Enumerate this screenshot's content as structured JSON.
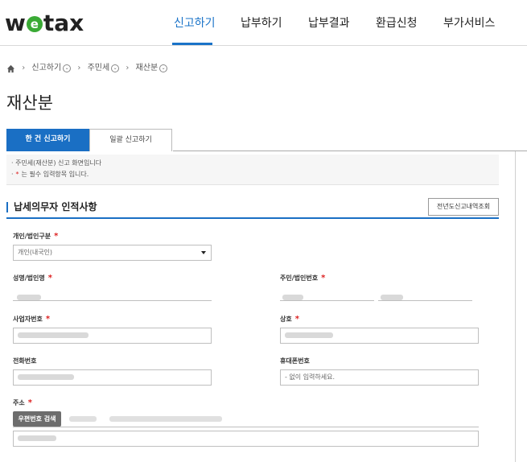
{
  "header": {
    "logo_before": "w",
    "logo_mark": "e",
    "logo_after": "tax",
    "nav": [
      "신고하기",
      "납부하기",
      "납부결과",
      "환급신청",
      "부가서비스"
    ],
    "active_nav": "신고하기"
  },
  "breadcrumb": {
    "home_icon": "home-icon",
    "items": [
      "신고하기",
      "주민세",
      "재산분"
    ]
  },
  "page_title": "재산분",
  "tabs": [
    "한 건 신고하기",
    "일괄 신고하기"
  ],
  "notice": {
    "line1": "· 주민세(재산분) 신고 화면입니다",
    "line2_pre": "·",
    "line2_star": "*",
    "line2_post": "는 필수 입력항목 입니다."
  },
  "section": {
    "title": "납세의무자 인적사항",
    "history_button": "전년도신고내역조회"
  },
  "form": {
    "type_label": "개인/법인구분",
    "type_value": "개인(내국인)",
    "name_label": "성명/법인명",
    "id_label": "주민/법인번호",
    "biz_label": "사업자번호",
    "trade_label": "상호",
    "phone_label": "전화번호",
    "mobile_label": "휴대폰번호",
    "mobile_placeholder": "- 없이 입력하세요.",
    "address_label": "주소",
    "zip_button": "우편번호 검색",
    "required_mark": "*"
  },
  "colors": {
    "accent": "#1a6fc4",
    "required": "#dd2222",
    "logo_mark": "#3aaa35"
  }
}
